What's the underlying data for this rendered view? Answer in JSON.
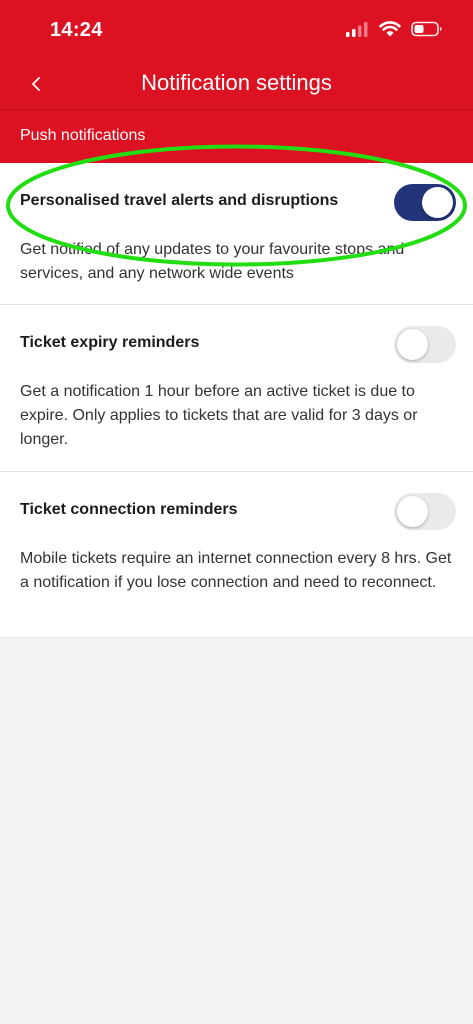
{
  "status_bar": {
    "time": "14:24"
  },
  "nav": {
    "title": "Notification settings",
    "back_icon": "chevron-left-icon"
  },
  "section": {
    "header": "Push notifications"
  },
  "settings": [
    {
      "title": "Personalised travel alerts and disruptions",
      "description": "Get notified of any updates to your favourite stops and services, and any network wide events",
      "enabled": true
    },
    {
      "title": "Ticket expiry reminders",
      "description": "Get a notification 1 hour before an active ticket is due to expire. Only applies to tickets that are valid for 3 days or longer.",
      "enabled": false
    },
    {
      "title": "Ticket connection reminders",
      "description": "Mobile tickets require an internet connection every 8 hrs. Get a notification if you lose connection and need to reconnect.",
      "enabled": false
    }
  ],
  "colors": {
    "brand_red": "#dc1122",
    "toggle_on": "#23357a",
    "toggle_off": "#eaeaea",
    "highlight": "#22dd11"
  }
}
